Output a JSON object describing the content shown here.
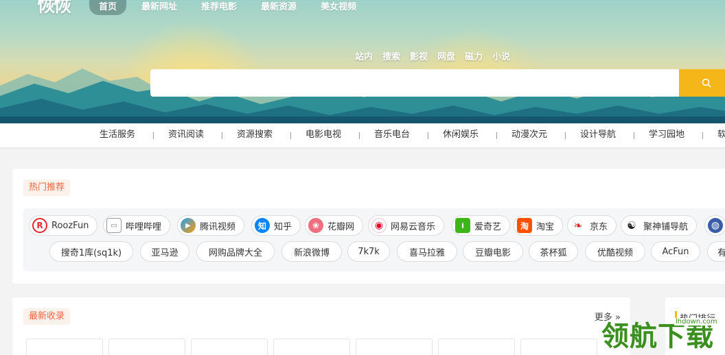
{
  "header": {
    "logo_text": "恢恢",
    "nav": [
      "首页",
      "最新网址",
      "推荐电影",
      "最新资源",
      "美女视频"
    ]
  },
  "search": {
    "tabs": [
      "站内",
      "搜索",
      "影视",
      "网盘",
      "磁力",
      "小说"
    ],
    "placeholder": "",
    "value": "",
    "button_icon": "search-icon",
    "button_color": "#f5b619"
  },
  "categories": [
    "生活服务",
    "资讯阅读",
    "资源搜索",
    "电影电视",
    "音乐电台",
    "休闲娱乐",
    "动漫次元",
    "设计导航",
    "学习园地",
    "软"
  ],
  "hot": {
    "title": "热门推荐",
    "row1": [
      {
        "label": "RoozFun",
        "icon": "roozfun-logo-icon",
        "color": "#e8262b",
        "glyph": "R"
      },
      {
        "label": "哔哩哔哩",
        "icon": "bilibili-tv-icon",
        "color": "#8a8a8a",
        "glyph": "📺"
      },
      {
        "label": "腾讯视频",
        "icon": "tencent-video-play-icon",
        "color": "#20a0ff",
        "glyph": "▶"
      },
      {
        "label": "知乎",
        "icon": "zhihu-logo-icon",
        "color": "#0a84ff",
        "glyph": "知"
      },
      {
        "label": "花瓣网",
        "icon": "huaban-petal-icon",
        "color": "#ef6e7f",
        "glyph": "❀"
      },
      {
        "label": "网易云音乐",
        "icon": "netease-music-icon",
        "color": "#e60026",
        "glyph": "◉"
      },
      {
        "label": "爱奇艺",
        "icon": "iqiyi-logo-icon",
        "color": "#3fb618",
        "glyph": "i"
      },
      {
        "label": "淘宝",
        "icon": "taobao-logo-icon",
        "color": "#ff5000",
        "glyph": "淘"
      },
      {
        "label": "京东",
        "icon": "jd-dog-icon",
        "color": "#e1251b",
        "glyph": "❧"
      },
      {
        "label": "聚神铺导航",
        "icon": "jushenpu-logo-icon",
        "color": "#222222",
        "glyph": "☯"
      },
      {
        "label": "",
        "icon": "globe-icon",
        "color": "#3a5da8",
        "glyph": "◍"
      }
    ],
    "row2": [
      "搜奇1库(sq1k)",
      "亚马逊",
      "网购品牌大全",
      "新浪微博",
      "7k7k",
      "喜马拉雅",
      "豆瓣电影",
      "茶杯狐",
      "优酷视频",
      "AcFun",
      "有"
    ]
  },
  "latest": {
    "title": "最新收录",
    "more_label": "更多 »"
  },
  "ranking": {
    "title": "热门排行"
  },
  "watermark": {
    "text": "领航下载",
    "url": "lhdown.com"
  }
}
